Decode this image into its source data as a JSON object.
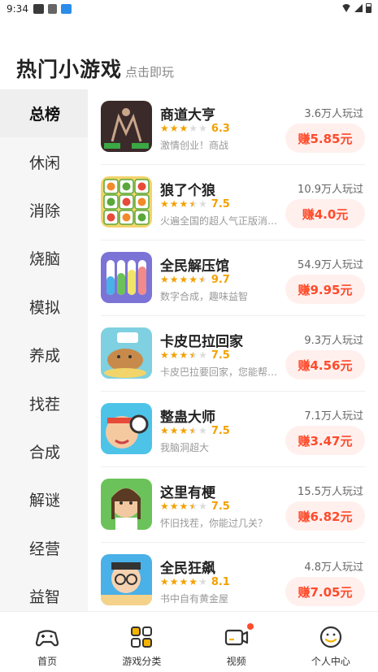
{
  "status_bar": {
    "time": "9:34"
  },
  "header": {
    "title": "热门小游戏",
    "subtitle": "点击即玩"
  },
  "categories": [
    {
      "label": "总榜",
      "active": true
    },
    {
      "label": "休闲"
    },
    {
      "label": "消除"
    },
    {
      "label": "烧脑"
    },
    {
      "label": "模拟"
    },
    {
      "label": "养成"
    },
    {
      "label": "找茬"
    },
    {
      "label": "合成"
    },
    {
      "label": "解谜"
    },
    {
      "label": "经营"
    },
    {
      "label": "益智"
    }
  ],
  "games": [
    {
      "name": "商道大亨",
      "rating": "6.3",
      "stars": 3,
      "desc": "激情创业！商战",
      "players": "3.6万人玩过",
      "earn": "赚5.85元",
      "thumb_color": "#3a2a2a",
      "thumb_accent": "#c9a58a"
    },
    {
      "name": "狼了个狼",
      "rating": "7.5",
      "stars": 3.5,
      "desc": "火遍全国的超人气正版消除游戏",
      "players": "10.9万人玩过",
      "earn": "赚4.0元",
      "thumb_color": "#f3d36b",
      "thumb_accent": "#5aa83a"
    },
    {
      "name": "全民解压馆",
      "rating": "9.7",
      "stars": 4.5,
      "desc": "数字合成，趣味益智",
      "players": "54.9万人玩过",
      "earn": "赚9.95元",
      "thumb_color": "#7b73d6",
      "thumb_accent": "#f2e36a"
    },
    {
      "name": "卡皮巴拉回家",
      "rating": "7.5",
      "stars": 3.5,
      "desc": "卡皮巴拉要回家，您能帮帮它吗",
      "players": "9.3万人玩过",
      "earn": "赚4.56元",
      "thumb_color": "#7fd0e0",
      "thumb_accent": "#c88a4a"
    },
    {
      "name": "整蛊大师",
      "rating": "7.5",
      "stars": 3.5,
      "desc": "我脑洞超大",
      "players": "7.1万人玩过",
      "earn": "赚3.47元",
      "thumb_color": "#4ec3e8",
      "thumb_accent": "#e84a3a"
    },
    {
      "name": "这里有梗",
      "rating": "7.5",
      "stars": 3.5,
      "desc": "怀旧找茬，你能过几关？",
      "players": "15.5万人玩过",
      "earn": "赚6.82元",
      "thumb_color": "#6cc25a",
      "thumb_accent": "#f2c8a0"
    },
    {
      "name": "全民狂飙",
      "rating": "8.1",
      "stars": 4,
      "desc": "书中自有黄金屋",
      "players": "4.8万人玩过",
      "earn": "赚7.05元",
      "thumb_color": "#4ab0e8",
      "thumb_accent": "#f5d28a"
    }
  ],
  "bottom_nav": [
    {
      "label": "首页",
      "icon": "gamepad-icon"
    },
    {
      "label": "游戏分类",
      "icon": "grid-icon",
      "active": true
    },
    {
      "label": "视频",
      "icon": "video-icon",
      "badge": true
    },
    {
      "label": "个人中心",
      "icon": "smile-icon"
    }
  ],
  "colors": {
    "accent": "#ff4a2a",
    "star": "#f2a100",
    "earn_bg": "#fff0ee",
    "sidebar_bg": "#f6f6f6",
    "nav_active": "#f5b400"
  }
}
